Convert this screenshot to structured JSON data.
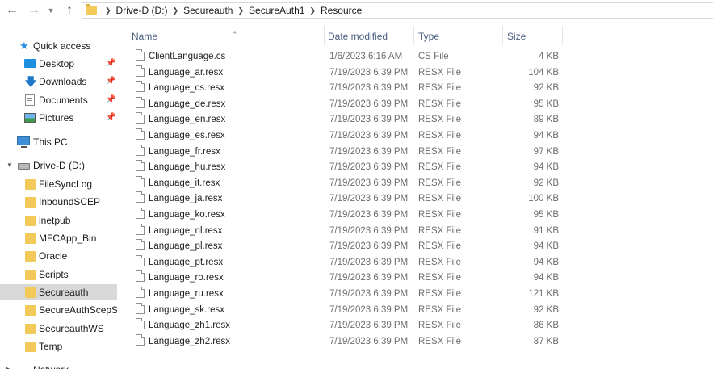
{
  "address_bar": {
    "crumbs": [
      "Drive-D (D:)",
      "Secureauth",
      "SecureAuth1",
      "Resource"
    ]
  },
  "nav": {
    "quick_access": "Quick access",
    "desktop": "Desktop",
    "downloads": "Downloads",
    "documents": "Documents",
    "pictures": "Pictures",
    "this_pc": "This PC",
    "drive": "Drive-D (D:)",
    "folders": [
      "FileSyncLog",
      "InboundSCEP",
      "inetpub",
      "MFCApp_Bin",
      "Oracle",
      "Scripts",
      "Secureauth",
      "SecureAuthScepSer",
      "SecureauthWS",
      "Temp"
    ],
    "selected_folder": "Secureauth",
    "network_partial": "Network"
  },
  "columns": {
    "name": "Name",
    "date": "Date modified",
    "type": "Type",
    "size": "Size"
  },
  "files": [
    {
      "name": "ClientLanguage.cs",
      "date": "1/6/2023 6:16 AM",
      "type": "CS File",
      "size": "4 KB"
    },
    {
      "name": "Language_ar.resx",
      "date": "7/19/2023 6:39 PM",
      "type": "RESX File",
      "size": "104 KB"
    },
    {
      "name": "Language_cs.resx",
      "date": "7/19/2023 6:39 PM",
      "type": "RESX File",
      "size": "92 KB"
    },
    {
      "name": "Language_de.resx",
      "date": "7/19/2023 6:39 PM",
      "type": "RESX File",
      "size": "95 KB"
    },
    {
      "name": "Language_en.resx",
      "date": "7/19/2023 6:39 PM",
      "type": "RESX File",
      "size": "89 KB"
    },
    {
      "name": "Language_es.resx",
      "date": "7/19/2023 6:39 PM",
      "type": "RESX File",
      "size": "94 KB"
    },
    {
      "name": "Language_fr.resx",
      "date": "7/19/2023 6:39 PM",
      "type": "RESX File",
      "size": "97 KB"
    },
    {
      "name": "Language_hu.resx",
      "date": "7/19/2023 6:39 PM",
      "type": "RESX File",
      "size": "94 KB"
    },
    {
      "name": "Language_it.resx",
      "date": "7/19/2023 6:39 PM",
      "type": "RESX File",
      "size": "92 KB"
    },
    {
      "name": "Language_ja.resx",
      "date": "7/19/2023 6:39 PM",
      "type": "RESX File",
      "size": "100 KB"
    },
    {
      "name": "Language_ko.resx",
      "date": "7/19/2023 6:39 PM",
      "type": "RESX File",
      "size": "95 KB"
    },
    {
      "name": "Language_nl.resx",
      "date": "7/19/2023 6:39 PM",
      "type": "RESX File",
      "size": "91 KB"
    },
    {
      "name": "Language_pl.resx",
      "date": "7/19/2023 6:39 PM",
      "type": "RESX File",
      "size": "94 KB"
    },
    {
      "name": "Language_pt.resx",
      "date": "7/19/2023 6:39 PM",
      "type": "RESX File",
      "size": "94 KB"
    },
    {
      "name": "Language_ro.resx",
      "date": "7/19/2023 6:39 PM",
      "type": "RESX File",
      "size": "94 KB"
    },
    {
      "name": "Language_ru.resx",
      "date": "7/19/2023 6:39 PM",
      "type": "RESX File",
      "size": "121 KB"
    },
    {
      "name": "Language_sk.resx",
      "date": "7/19/2023 6:39 PM",
      "type": "RESX File",
      "size": "92 KB"
    },
    {
      "name": "Language_zh1.resx",
      "date": "7/19/2023 6:39 PM",
      "type": "RESX File",
      "size": "86 KB"
    },
    {
      "name": "Language_zh2.resx",
      "date": "7/19/2023 6:39 PM",
      "type": "RESX File",
      "size": "87 KB"
    }
  ],
  "colors": {
    "folder": "#f3c95a",
    "selected_bg": "#d9d9d9",
    "header_text": "#4d6082"
  }
}
